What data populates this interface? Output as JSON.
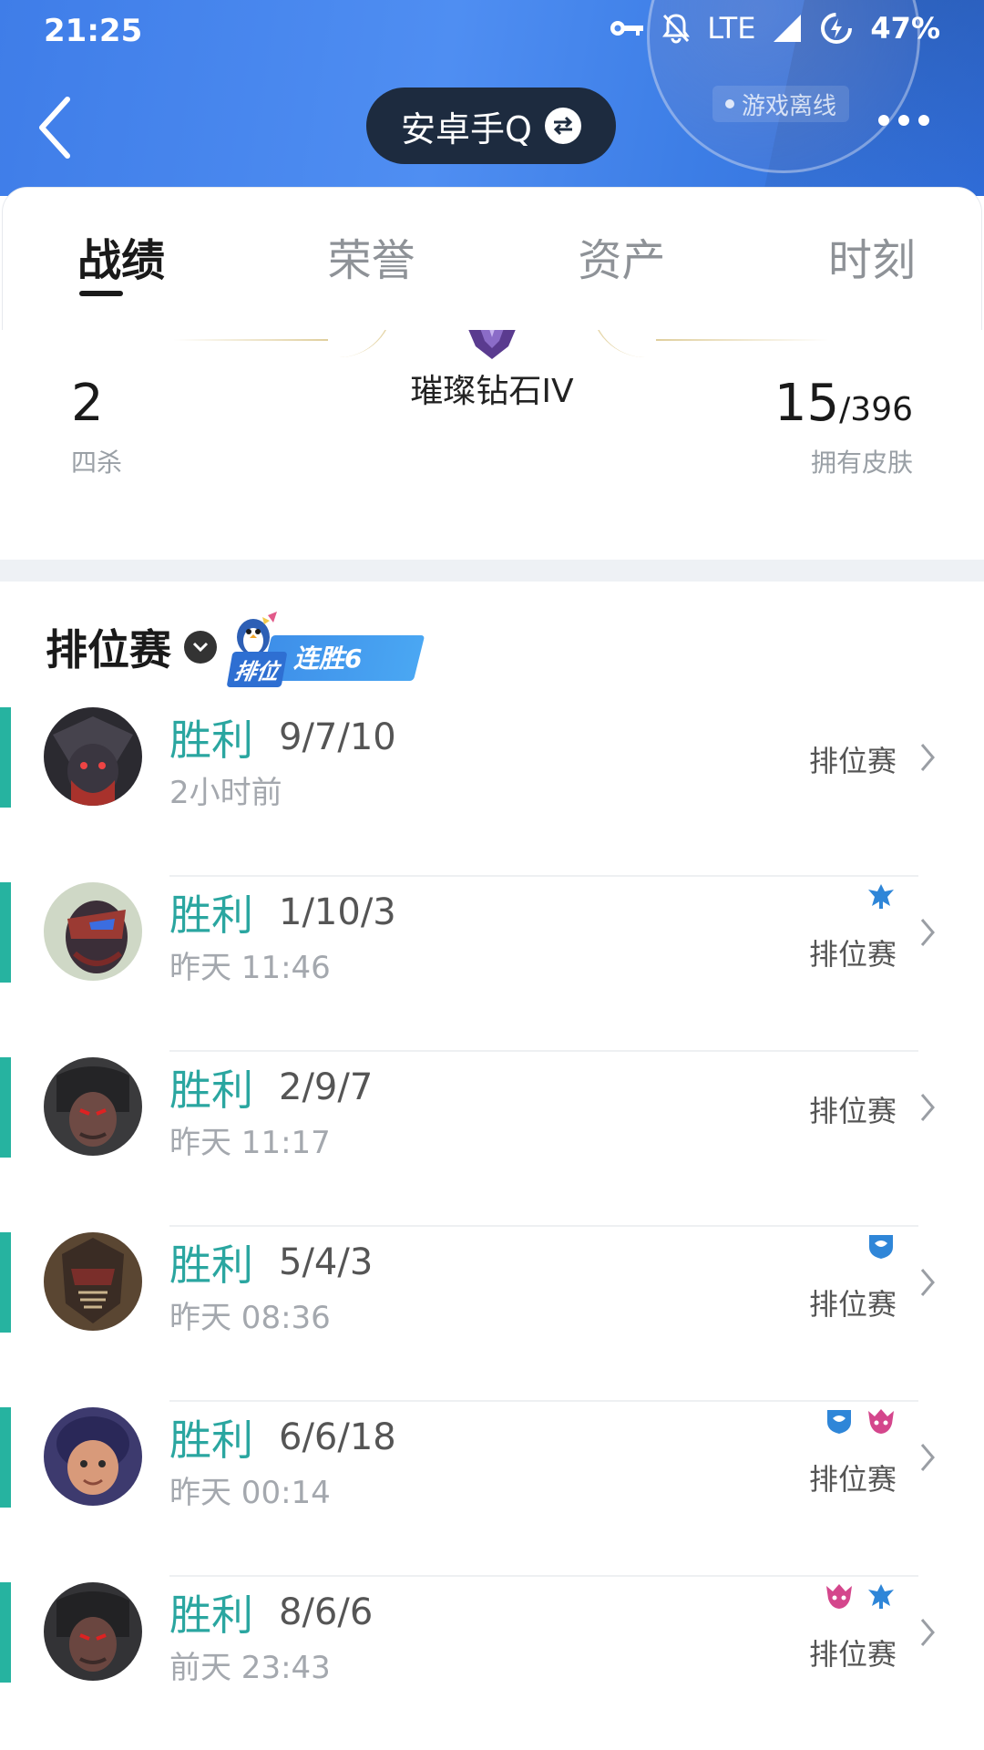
{
  "status_bar": {
    "time": "21:25",
    "network": "LTE",
    "battery": "47%"
  },
  "header": {
    "account_name": "安卓手Q",
    "game_status": "游戏离线"
  },
  "tabs": [
    {
      "label": "战绩",
      "active": true
    },
    {
      "label": "荣誉",
      "active": false
    },
    {
      "label": "资产",
      "active": false
    },
    {
      "label": "时刻",
      "active": false
    }
  ],
  "stats": {
    "rank_name": "璀璨钻石IV",
    "left_value": "2",
    "left_label": "四杀",
    "right_value": "15",
    "right_total": "/396",
    "right_label": "拥有皮肤"
  },
  "section": {
    "title": "排位赛",
    "streak_rank_tag": "排位",
    "streak_text": "连胜6"
  },
  "matches": [
    {
      "result": "胜利",
      "kda": "9/7/10",
      "time": "2小时前",
      "mode": "排位赛",
      "badges": [],
      "avatar_colors": [
        "#2b2a30",
        "#a8322c"
      ]
    },
    {
      "result": "胜利",
      "kda": "1/10/3",
      "time": "昨天 11:46",
      "mode": "排位赛",
      "badges": [
        "blue-fork-icon"
      ],
      "avatar_colors": [
        "#cfd8c6",
        "#9b3a33"
      ]
    },
    {
      "result": "胜利",
      "kda": "2/9/7",
      "time": "昨天 11:17",
      "mode": "排位赛",
      "badges": [],
      "avatar_colors": [
        "#3a3a3c",
        "#6e4a44"
      ]
    },
    {
      "result": "胜利",
      "kda": "5/4/3",
      "time": "昨天 08:36",
      "mode": "排位赛",
      "badges": [
        "blue-shield-icon"
      ],
      "avatar_colors": [
        "#5a4632",
        "#7a2e2a"
      ]
    },
    {
      "result": "胜利",
      "kda": "6/6/18",
      "time": "昨天 00:14",
      "mode": "排位赛",
      "badges": [
        "blue-shield-icon",
        "pink-demon-icon"
      ],
      "avatar_colors": [
        "#3d3a6e",
        "#d89a7a"
      ]
    },
    {
      "result": "胜利",
      "kda": "8/6/6",
      "time": "前天 23:43",
      "mode": "排位赛",
      "badges": [
        "pink-demon-icon",
        "blue-fork-icon"
      ],
      "avatar_colors": [
        "#333336",
        "#6a4640"
      ]
    }
  ],
  "colors": {
    "win": "#2aa6a0",
    "accent_bar": "#26b3a0",
    "header_blue": "#4f8ef2",
    "pill_bg": "#1d2b3f"
  }
}
